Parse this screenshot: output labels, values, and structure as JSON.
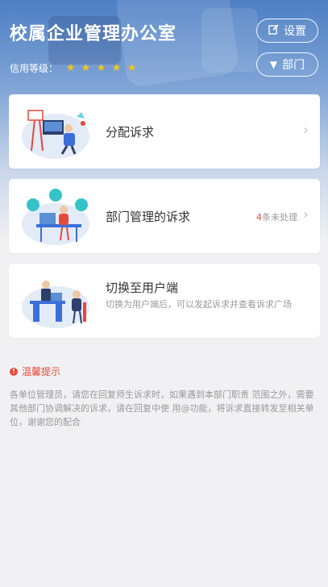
{
  "header": {
    "title": "校属企业管理办公室",
    "credit_label": "信用等级：",
    "credit_stars": 5,
    "star_color": "#f5c518",
    "settings_label": "设置",
    "dept_label": "部门",
    "settings_icon": "edit-icon",
    "dept_icon": "triangle-down-icon"
  },
  "cards": [
    {
      "title": "分配诉求",
      "illustration": "assign-illustration"
    },
    {
      "title": "部门管理的诉求",
      "pending_count": "4",
      "pending_suffix": "条未处理",
      "illustration": "department-illustration"
    },
    {
      "title": "切换至用户端",
      "subtitle": "切换为用户端后，可以发起诉求并查看诉求广场",
      "illustration": "switch-user-illustration"
    }
  ],
  "tips": {
    "title": "温馨提示",
    "body": "各单位管理员，请您在回复师生诉求时，如果遇到本部门职责 范围之外，需要其他部门协调解决的诉求，请在回复中使 用@功能，将诉求直接转发至相关单位，谢谢您的配合"
  },
  "colors": {
    "accent": "#e8483b",
    "brand_blue": "#4d7fc4"
  }
}
